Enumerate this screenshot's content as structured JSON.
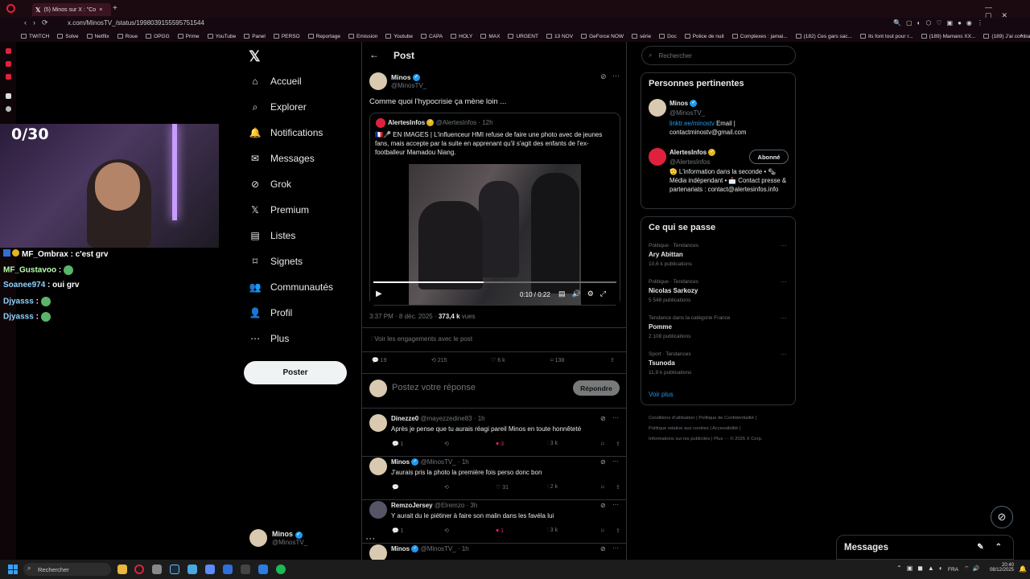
{
  "browser": {
    "tab_title": "(5) Minos sur X : \"Co",
    "url": "x.com/MinosTV_/status/1998039155595751544",
    "bookmarks": [
      "TWITCH",
      "Solve",
      "Netflix",
      "Roue",
      "OPGG",
      "Prime",
      "YouTube",
      "Panel",
      "PERSO",
      "Reportage",
      "Emission",
      "Youtube",
      "CAPA",
      "HOLY",
      "MAX",
      "URGENT",
      "13 NOV",
      "GeForce NOW",
      "série",
      "Doc",
      "Police de nuit",
      "Complexes : jamai...",
      "(182) Ces gars sac...",
      "Ils font tout pour r...",
      "(189) Mamans XX...",
      "(189) J'ai combatt..."
    ]
  },
  "stream": {
    "counter": "0/30",
    "chat": [
      {
        "user": "MF_Ombrax",
        "msg": " : c'est grv",
        "emote": false
      },
      {
        "user": "MF_Gustavoo",
        "msg": " :",
        "emote": true
      },
      {
        "user": "Soanee974",
        "msg": " : oui grv",
        "emote": false
      },
      {
        "user": "Djyasss",
        "msg": " :",
        "emote": true
      },
      {
        "user": "Djyasss",
        "msg": " :",
        "emote": true
      }
    ]
  },
  "nav": {
    "items": [
      "Accueil",
      "Explorer",
      "Notifications",
      "Messages",
      "Grok",
      "Premium",
      "Listes",
      "Signets",
      "Communautés",
      "Profil",
      "Plus"
    ],
    "post_label": "Poster",
    "me_name": "Minos",
    "me_handle": "@MinosTV_"
  },
  "post": {
    "header": "Post",
    "author": "Minos",
    "handle": "@MinosTV_",
    "text": "Comme quoi l'hypocrisie ça mène loin ...",
    "quote": {
      "author": "AlertesInfos",
      "handle": "@AlertesInfos",
      "time": "· 12h",
      "text": "🇫🇷🎤 EN IMAGES | L'influenceur HMI refuse de faire une photo avec de jeunes fans, mais accepte par la suite en apprenant qu'il s'agit des enfants de l'ex-footballeur Mamadou Niang."
    },
    "video_time": "0:10 / 0:22",
    "meta_time": "3:37 PM · 8 déc. 2025 · ",
    "views": "373,4 k",
    "views_label": " vues",
    "engagements": "Voir les engagements avec le post",
    "stats": {
      "replies": "19",
      "reposts": "215",
      "likes": "6 k",
      "bookmarks": "138"
    },
    "reply_placeholder": "Postez votre réponse",
    "reply_button": "Répondre"
  },
  "replies": [
    {
      "name": "Dinezze0",
      "handle": "@mayezzedine83 · 1h",
      "text": "Après je pense que tu aurais réagi pareil Minos en toute honnêteté",
      "r": "1",
      "rt": "",
      "l": "3",
      "v": "3 k",
      "liked": true,
      "verified": false
    },
    {
      "name": "Minos",
      "handle": "@MinosTV_ · 1h",
      "text": "J'aurais pris la photo la première fois perso donc bon",
      "r": "",
      "rt": "",
      "l": "31",
      "v": "2 k",
      "liked": false,
      "verified": true
    },
    {
      "name": "RemzoJersey",
      "handle": "@Elremzo · 3h",
      "text": "Y aurait du le piétiner à faire son malin dans les favéla lui",
      "r": "1",
      "rt": "",
      "l": "1",
      "v": "3 k",
      "liked": true,
      "verified": false
    },
    {
      "name": "Minos",
      "handle": "@MinosTV_ · 1h",
      "text": "",
      "r": "",
      "rt": "",
      "l": "",
      "v": "",
      "liked": false,
      "verified": true
    }
  ],
  "sidebar": {
    "search_placeholder": "Rechercher",
    "relevant_title": "Personnes pertinentes",
    "p1_name": "Minos",
    "p1_handle": "@MinosTV_",
    "p1_link": "linktr.ee/minostv",
    "p1_bio": " Email | contactminostv@gmail.com",
    "p2_name": "AlertesInfos",
    "p2_handle": "@AlertesInfos",
    "p2_bio": "🫡 L'information dans la seconde • 🗞 Média indépendant • 📩 Contact presse & partenariats : contact@alertesinfos.info",
    "p2_follow": "Abonné",
    "trends_title": "Ce qui se passe",
    "trends": [
      {
        "meta": "Politique · Tendances",
        "name": "Ary Abittan",
        "count": "10,6 k publications"
      },
      {
        "meta": "Politique · Tendances",
        "name": "Nicolas Sarkozy",
        "count": "5 548 publications"
      },
      {
        "meta": "Tendance dans la catégorie France",
        "name": "Pomme",
        "count": "2 108 publications"
      },
      {
        "meta": "Sport · Tendances",
        "name": "Tsunoda",
        "count": "11,9 k publications"
      }
    ],
    "see_more": "Voir plus",
    "footer1": "Conditions d'utilisation  |  Politique de Confidentialité  |",
    "footer2": "Politique relative aux cookies  |  Accessibilité  |",
    "footer3": "Informations sur les publicités  |  Plus ···  © 2025 X Corp."
  },
  "messages_dock": "Messages",
  "taskbar": {
    "search": "Rechercher",
    "lang": "FRA",
    "time": "20:40",
    "date": "08/12/2025"
  }
}
